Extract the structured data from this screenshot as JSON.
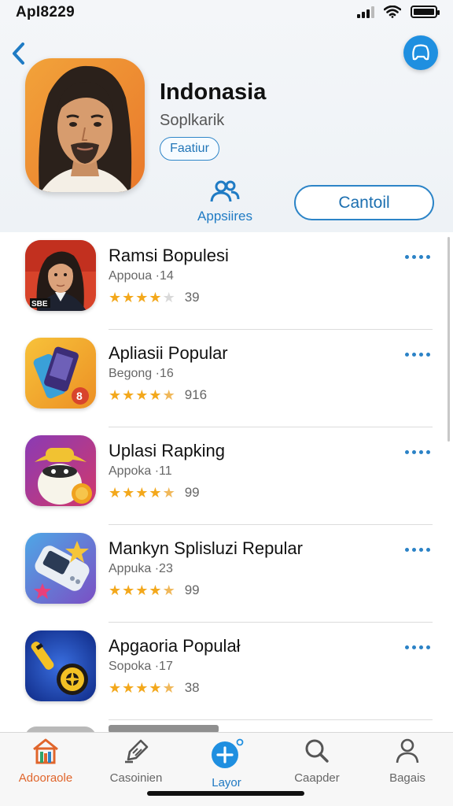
{
  "status_bar": {
    "time": "ApI8229"
  },
  "profile": {
    "name": "Indonasia",
    "subtitle": "Soplkarik",
    "chip": "Faatiur",
    "apps_label": "Appsiires",
    "cancel_label": "Cantoil"
  },
  "apps": [
    {
      "title": "Ramsi  Bopulesi",
      "category": "Appoua ·14",
      "stars": 4,
      "rating_count": "39",
      "icon": "portrait-icon"
    },
    {
      "title": "Apliasii Popular",
      "category": "Begong ·16",
      "stars": 4.5,
      "rating_count": "916",
      "icon": "phone-icon"
    },
    {
      "title": "Uplasi Rapking",
      "category": "Appoka ·11",
      "stars": 4.5,
      "rating_count": "99",
      "icon": "character-icon"
    },
    {
      "title": "Mankyn Splisluzi Repular",
      "category": "Appuka ·23",
      "stars": 4.5,
      "rating_count": "99",
      "icon": "device-icon"
    },
    {
      "title": "Apgaoria Populał",
      "category": "Sopoka ·17",
      "stars": 4.5,
      "rating_count": "38",
      "icon": "guitar-icon"
    }
  ],
  "tabs": [
    {
      "label": "Adooraole",
      "icon": "home-icon",
      "active": true
    },
    {
      "label": "Casoinien",
      "icon": "categories-icon"
    },
    {
      "label": "Layor",
      "icon": "plus-icon"
    },
    {
      "label": "Caapder",
      "icon": "search-icon"
    },
    {
      "label": "Bagais",
      "icon": "profile-icon"
    }
  ],
  "colors": {
    "accent": "#1f8fe0",
    "star": "#f3a81c",
    "active_tab": "#e0652b"
  }
}
